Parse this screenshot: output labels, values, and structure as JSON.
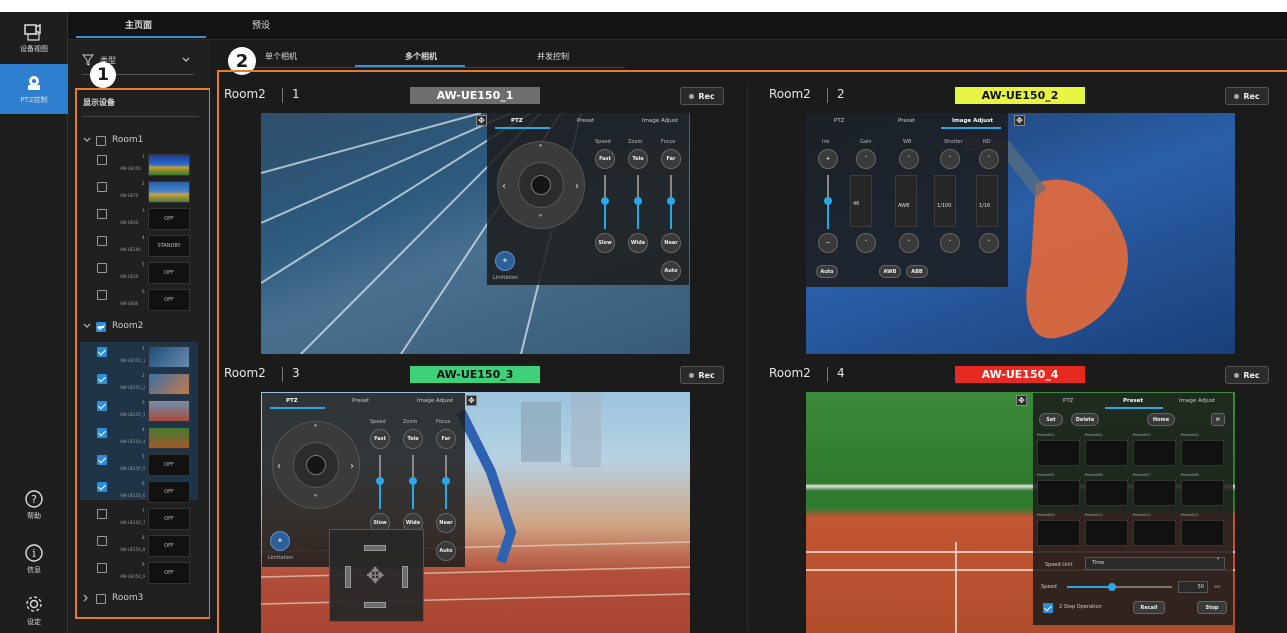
{
  "rail": {
    "device_view": "设备视图",
    "ptz_control": "PTZ控制",
    "help": "帮助",
    "info": "信息",
    "settings": "设定"
  },
  "top_tabs": {
    "main": "主页面",
    "preset": "预设"
  },
  "sub_tabs": {
    "single": "单个相机",
    "multi": "多个相机",
    "sync": "并发控制"
  },
  "filter": {
    "label": "类型"
  },
  "side_heading": "显示设备",
  "badges": {
    "one": "1",
    "two": "2"
  },
  "groups": [
    {
      "name": "Room1",
      "devices": [
        {
          "num": "1",
          "name": "AW-UE150",
          "status": ""
        },
        {
          "num": "2",
          "name": "AW-UE70",
          "status": ""
        },
        {
          "num": "3",
          "name": "AW-HE40",
          "status": "OFF"
        },
        {
          "num": "4",
          "name": "AW-UE100",
          "status": "STANDBY"
        },
        {
          "num": "5",
          "name": "AW-UE20",
          "status": "OFF"
        },
        {
          "num": "6",
          "name": "AW-UE80",
          "status": "OFF"
        }
      ]
    },
    {
      "name": "Room2",
      "devices": [
        {
          "num": "1",
          "name": "AW-UE150_1",
          "status": ""
        },
        {
          "num": "2",
          "name": "AW-UE150_2",
          "status": ""
        },
        {
          "num": "3",
          "name": "AW-UE150_3",
          "status": ""
        },
        {
          "num": "4",
          "name": "AW-UE150_4",
          "status": ""
        },
        {
          "num": "5",
          "name": "AW-UE150_5",
          "status": "OFF"
        },
        {
          "num": "6",
          "name": "AW-UE150_6",
          "status": "OFF"
        },
        {
          "num": "7",
          "name": "AW-UE150_7",
          "status": "OFF"
        },
        {
          "num": "8",
          "name": "AW-UE150_8",
          "status": "OFF"
        },
        {
          "num": "9",
          "name": "AW-UE150_9",
          "status": "OFF"
        }
      ]
    },
    {
      "name": "Room3",
      "devices": []
    }
  ],
  "cameras": [
    {
      "room": "Room2",
      "num": "1",
      "name": "AW-UE150_1",
      "tag_color": "#6e6e6e",
      "tag_text_color": "#ffffff",
      "rec": "Rec"
    },
    {
      "room": "Room2",
      "num": "2",
      "name": "AW-UE150_2",
      "tag_color": "#e7f542",
      "tag_text_color": "#111111",
      "rec": "Rec"
    },
    {
      "room": "Room2",
      "num": "3",
      "name": "AW-UE150_3",
      "tag_color": "#3ed07a",
      "tag_text_color": "#111111",
      "rec": "Rec"
    },
    {
      "room": "Room2",
      "num": "4",
      "name": "AW-UE150_4",
      "tag_color": "#e62a22",
      "tag_text_color": "#ffffff",
      "rec": "Rec"
    }
  ],
  "ptz_panel": {
    "tabs": [
      "PTZ",
      "Preset",
      "Image Adjust"
    ],
    "cols": [
      "Speed",
      "Zoom",
      "Focus"
    ],
    "top_btns": [
      "Fast",
      "Tele",
      "Far"
    ],
    "bottom_btns": [
      "Slow",
      "Wide",
      "Near"
    ],
    "auto": "Auto",
    "limitation": "Limitation"
  },
  "image_panel": {
    "cols": [
      "Iris",
      "Gain",
      "WB",
      "Shutter",
      "ND"
    ],
    "gain_value": "46",
    "shutter_value": "1/100",
    "nd_value": "1/16",
    "wb_value": "AWB",
    "auto": "Auto",
    "awb": "AWB",
    "abb": "ABB"
  },
  "preset_panel": {
    "set": "Set",
    "delete": "Delete",
    "home": "Home",
    "presets": [
      "Preset001",
      "Preset002",
      "Preset003",
      "Preset004",
      "Preset005",
      "Preset006",
      "Preset007",
      "Preset008",
      "Preset009",
      "Preset010",
      "Preset011",
      "Preset012"
    ],
    "speed_unit_label": "Speed Unit",
    "speed_unit_value": "Time",
    "speed_label": "Speed",
    "speed_value": "50",
    "speed_unit_suffix": "sec",
    "two_step": "2 Step Operation",
    "recall": "Recall",
    "stop": "Stop"
  }
}
